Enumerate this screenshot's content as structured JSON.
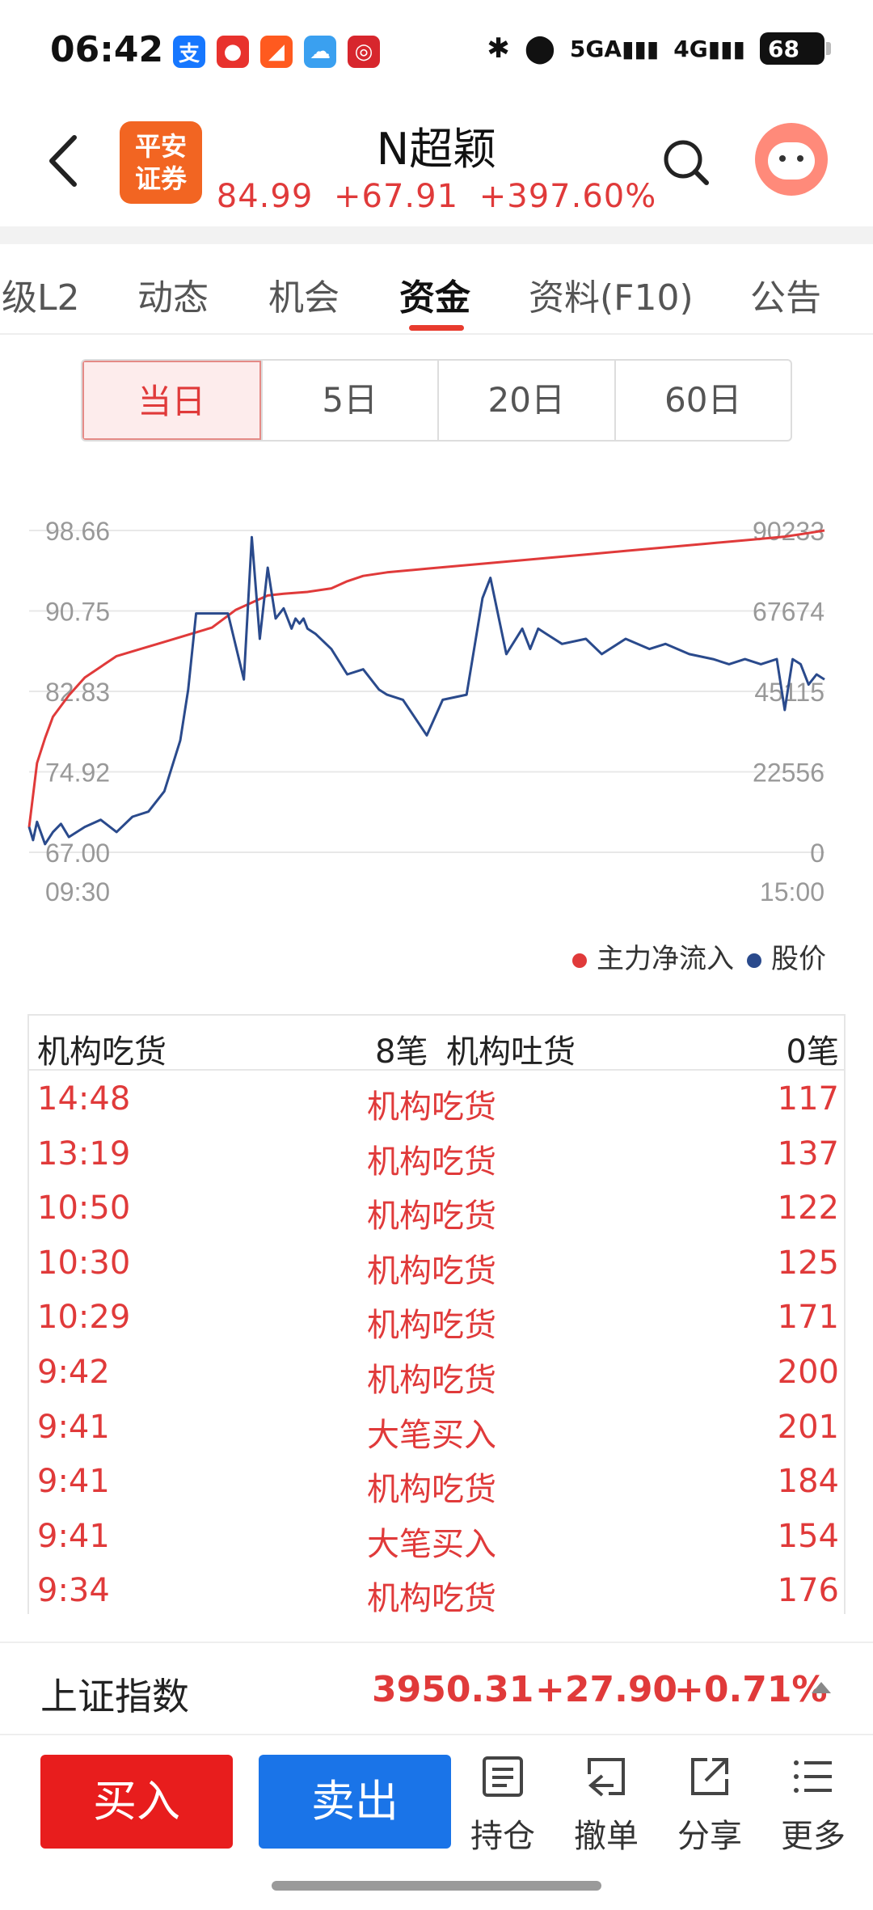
{
  "status_bar": {
    "time": "06:42",
    "apps": [
      {
        "name": "alipay-icon",
        "glyph": "支",
        "color": "#1677ff"
      },
      {
        "name": "app-red-icon",
        "glyph": "●",
        "color": "#e8322d"
      },
      {
        "name": "app-orange-icon",
        "glyph": "◢",
        "color": "#ff5a1f"
      },
      {
        "name": "weather-icon",
        "glyph": "☁",
        "color": "#3aa0f0"
      },
      {
        "name": "bank-icon",
        "glyph": "◎",
        "color": "#d7262d"
      }
    ],
    "signal_5g": "5GA",
    "signal_4g": "4G",
    "battery": "68"
  },
  "header": {
    "logo_line1": "平安",
    "logo_line2": "证券",
    "stock_name": "N超颖",
    "price": "84.99",
    "change": "+67.91",
    "change_pct": "+397.60%"
  },
  "tabs": [
    {
      "label": "级L2",
      "active": false
    },
    {
      "label": "动态",
      "active": false
    },
    {
      "label": "机会",
      "active": false
    },
    {
      "label": "资金",
      "active": true
    },
    {
      "label": "资料(F10)",
      "active": false
    },
    {
      "label": "公告",
      "active": false
    }
  ],
  "periods": [
    {
      "label": "当日",
      "active": true
    },
    {
      "label": "5日",
      "active": false
    },
    {
      "label": "20日",
      "active": false
    },
    {
      "label": "60日",
      "active": false
    }
  ],
  "chart_data": {
    "type": "line",
    "x_start_label": "09:30",
    "x_end_label": "15:00",
    "left_axis_ticks": [
      "98.66",
      "90.75",
      "82.83",
      "74.92",
      "67.00"
    ],
    "right_axis_ticks": [
      "90233",
      "67674",
      "45115",
      "22556",
      "0"
    ],
    "left_range": [
      67.0,
      98.66
    ],
    "right_range": [
      0,
      90233
    ],
    "grid": true,
    "legend_position": "bottom-right",
    "series": [
      {
        "name": "主力净流入",
        "color": "#e03a3a",
        "axis": "right",
        "x": [
          0,
          0.01,
          0.02,
          0.03,
          0.05,
          0.07,
          0.09,
          0.11,
          0.14,
          0.17,
          0.2,
          0.23,
          0.26,
          0.29,
          0.3,
          0.32,
          0.35,
          0.38,
          0.4,
          0.42,
          0.45,
          0.5,
          0.55,
          0.6,
          0.65,
          0.7,
          0.75,
          0.8,
          0.85,
          0.9,
          0.95,
          0.98,
          1.0
        ],
        "values": [
          7000,
          25000,
          32000,
          38000,
          44000,
          49000,
          52000,
          55000,
          57000,
          59000,
          61000,
          63000,
          68000,
          71000,
          72000,
          72500,
          73000,
          74000,
          76000,
          77500,
          78500,
          79500,
          80500,
          81500,
          82500,
          83500,
          84500,
          85500,
          86500,
          87500,
          88500,
          89500,
          90233
        ]
      },
      {
        "name": "股价",
        "color": "#2a4a8c",
        "axis": "left",
        "x": [
          0,
          0.005,
          0.01,
          0.02,
          0.03,
          0.04,
          0.05,
          0.07,
          0.09,
          0.11,
          0.13,
          0.15,
          0.17,
          0.19,
          0.2,
          0.21,
          0.23,
          0.24,
          0.25,
          0.27,
          0.28,
          0.29,
          0.3,
          0.31,
          0.32,
          0.33,
          0.335,
          0.34,
          0.345,
          0.35,
          0.36,
          0.38,
          0.4,
          0.42,
          0.44,
          0.45,
          0.47,
          0.5,
          0.52,
          0.55,
          0.57,
          0.58,
          0.6,
          0.62,
          0.63,
          0.64,
          0.65,
          0.66,
          0.67,
          0.7,
          0.72,
          0.75,
          0.78,
          0.8,
          0.83,
          0.86,
          0.88,
          0.9,
          0.92,
          0.94,
          0.95,
          0.96,
          0.97,
          0.98,
          0.99,
          1.0
        ],
        "values": [
          69.5,
          68.2,
          70.0,
          67.8,
          69.0,
          69.8,
          68.5,
          69.5,
          70.2,
          69.0,
          70.5,
          71.0,
          73.0,
          78.0,
          83.0,
          90.5,
          90.5,
          90.5,
          90.5,
          84.0,
          98.0,
          88.0,
          95.0,
          90.0,
          91.0,
          89.0,
          90.0,
          89.5,
          90.0,
          89.0,
          88.5,
          87.0,
          84.5,
          85.0,
          83.0,
          82.5,
          82.0,
          78.5,
          82.0,
          82.5,
          92.0,
          94.0,
          86.5,
          89.0,
          87.0,
          89.0,
          88.5,
          88.0,
          87.5,
          88.0,
          86.5,
          88.0,
          87.0,
          87.5,
          86.5,
          86.0,
          85.5,
          86.0,
          85.5,
          86.0,
          81.0,
          86.0,
          85.5,
          83.5,
          84.5,
          84.0
        ]
      }
    ]
  },
  "legend": {
    "inflow_label": "主力净流入",
    "price_label": "股价"
  },
  "table": {
    "header_left": "机构吃货",
    "header_left_count": "8笔",
    "header_right": "机构吐货",
    "header_right_count": "0笔",
    "rows": [
      {
        "time": "14:48",
        "kind": "机构吃货",
        "value": "117"
      },
      {
        "time": "13:19",
        "kind": "机构吃货",
        "value": "137"
      },
      {
        "time": "10:50",
        "kind": "机构吃货",
        "value": "122"
      },
      {
        "time": "10:30",
        "kind": "机构吃货",
        "value": "125"
      },
      {
        "time": "10:29",
        "kind": "机构吃货",
        "value": "171"
      },
      {
        "time": "9:42",
        "kind": "机构吃货",
        "value": "200"
      },
      {
        "time": "9:41",
        "kind": "大笔买入",
        "value": "201"
      },
      {
        "time": "9:41",
        "kind": "机构吃货",
        "value": "184"
      },
      {
        "time": "9:41",
        "kind": "大笔买入",
        "value": "154"
      },
      {
        "time": "9:34",
        "kind": "机构吃货",
        "value": "176"
      }
    ]
  },
  "index_bar": {
    "name": "上证指数",
    "value": "3950.31",
    "change": "+27.90",
    "change_pct": "+0.71%"
  },
  "bottom_bar": {
    "buy_label": "买入",
    "sell_label": "卖出",
    "positions_label": "持仓",
    "cancel_label": "撤单",
    "share_label": "分享",
    "more_label": "更多"
  }
}
